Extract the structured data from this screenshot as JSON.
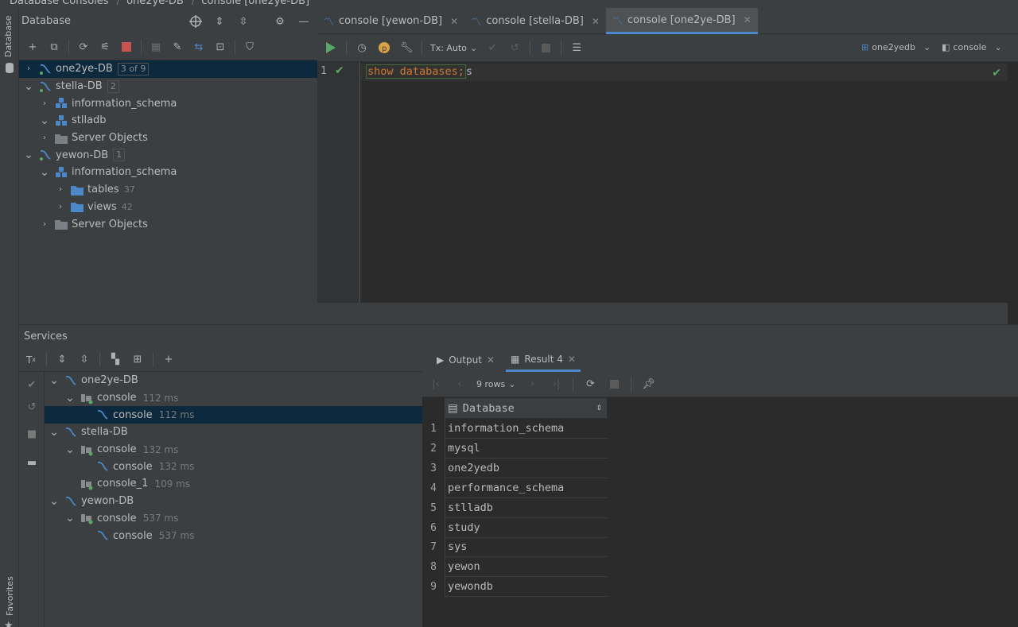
{
  "breadcrumb": [
    "Database Consoles",
    "one2ye-DB",
    "console [one2ye-DB]"
  ],
  "left_strip": {
    "database_label": "Database",
    "favorites_label": "Favorites"
  },
  "db_panel": {
    "title": "Database",
    "tree": [
      {
        "label": "one2ye-DB",
        "badge": "3 of 9",
        "expanded": false,
        "level": 0
      },
      {
        "label": "stella-DB",
        "badge": "2",
        "expanded": true,
        "level": 0
      },
      {
        "label": "information_schema",
        "expanded": false,
        "level": 1
      },
      {
        "label": "stlladb",
        "expanded": true,
        "level": 1
      },
      {
        "label": "Server Objects",
        "expanded": false,
        "level": 1
      },
      {
        "label": "yewon-DB",
        "badge": "1",
        "expanded": true,
        "level": 0
      },
      {
        "label": "information_schema",
        "expanded": true,
        "level": 1
      },
      {
        "label": "tables",
        "count": "37",
        "level": 2
      },
      {
        "label": "views",
        "count": "42",
        "level": 2
      },
      {
        "label": "Server Objects",
        "expanded": false,
        "level": 1
      }
    ]
  },
  "editor": {
    "tabs": [
      {
        "label": "console [yewon-DB]",
        "active": false
      },
      {
        "label": "console [stella-DB]",
        "active": false
      },
      {
        "label": "console [one2ye-DB]",
        "active": true
      }
    ],
    "tx_mode": "Tx: Auto",
    "schema_selector": "one2yedb",
    "session_selector": "console",
    "line_number": "1",
    "code_keyword": "show databases;",
    "code_rest": "s"
  },
  "services": {
    "title": "Services",
    "tree": [
      {
        "label": "one2ye-DB",
        "level": 0
      },
      {
        "label": "console",
        "time": "112 ms",
        "level": 1
      },
      {
        "label": "console",
        "time": "112 ms",
        "level": 2,
        "selected": true
      },
      {
        "label": "stella-DB",
        "level": 0
      },
      {
        "label": "console",
        "time": "132 ms",
        "level": 1
      },
      {
        "label": "console",
        "time": "132 ms",
        "level": 2
      },
      {
        "label": "console_1",
        "time": "109 ms",
        "level": 1
      },
      {
        "label": "yewon-DB",
        "level": 0
      },
      {
        "label": "console",
        "time": "537 ms",
        "level": 1
      },
      {
        "label": "console",
        "time": "537 ms",
        "level": 2
      }
    ]
  },
  "result": {
    "tabs": [
      {
        "label": "Output"
      },
      {
        "label": "Result 4",
        "active": true
      }
    ],
    "rows_label": "9 rows",
    "column": "Database",
    "rows": [
      "information_schema",
      "mysql",
      "one2yedb",
      "performance_schema",
      "stlladb",
      "study",
      "sys",
      "yewon",
      "yewondb"
    ]
  },
  "colors": {
    "accent": "#4a88c7",
    "keyword": "#cc7832",
    "success": "#59a869",
    "selection": "#0d293e"
  }
}
